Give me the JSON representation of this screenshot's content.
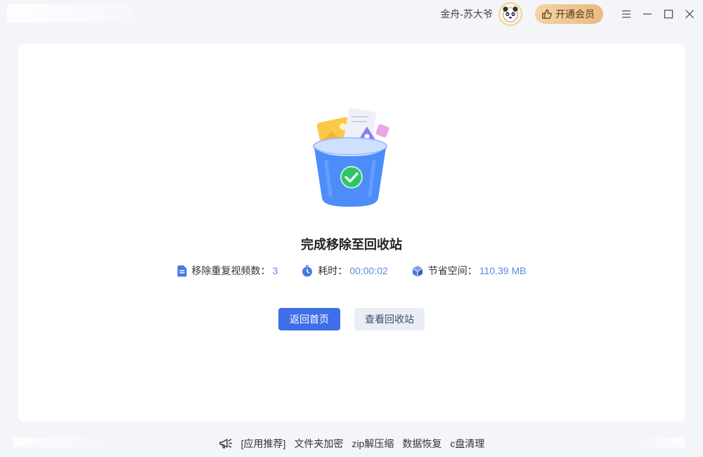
{
  "header": {
    "user_name": "金舟-苏大爷",
    "vip_label": "开通会员",
    "icons": {
      "avatar": "panda-avatar",
      "vip": "thumbs-up-icon",
      "menu": "menu-icon",
      "minimize": "minimize-icon",
      "maximize": "maximize-icon",
      "close": "close-icon"
    }
  },
  "result": {
    "title": "完成移除至回收站",
    "illustration": "recycle-bin-with-check",
    "stats": [
      {
        "icon": "document-icon",
        "label": "移除重复视频数：",
        "value": "3"
      },
      {
        "icon": "clock-icon",
        "label": "耗时：",
        "value": "00:00:02"
      },
      {
        "icon": "cube-icon",
        "label": "节省空间：",
        "value": "110.39 MB"
      }
    ]
  },
  "actions": {
    "home_label": "返回首页",
    "recycle_label": "查看回收站"
  },
  "footer": {
    "icon": "megaphone-icon",
    "recommend_label": "[应用推荐]",
    "links": [
      "文件夹加密",
      "zip解压缩",
      "数据恢复",
      "c盘清理"
    ]
  },
  "colors": {
    "accent": "#3f6fe8",
    "value_text": "#5b8be3",
    "vip_gold": "#e8bb80",
    "background": "#f3f5f9"
  }
}
